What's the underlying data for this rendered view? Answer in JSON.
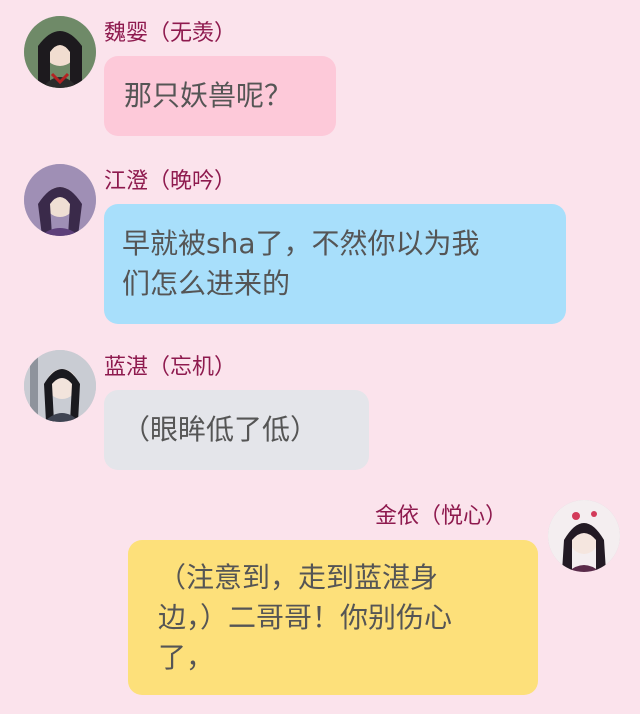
{
  "messages": [
    {
      "sender": "魏婴（无羡）",
      "side": "left",
      "bubble_color": "#fdc9d9",
      "lines": [
        "那只妖兽呢？"
      ]
    },
    {
      "sender": "江澄（晚吟）",
      "side": "left",
      "bubble_color": "#a8dffb",
      "lines": [
        "早就被sha了，不然你以为我",
        "们怎么进来的"
      ]
    },
    {
      "sender": "蓝湛（忘机）",
      "side": "left",
      "bubble_color": "#e4e5ea",
      "lines": [
        "（眼眸低了低）"
      ]
    },
    {
      "sender": "金依（悦心）",
      "side": "right",
      "bubble_color": "#fde07a",
      "lines": [
        "（注意到，走到蓝湛身",
        "边，）二哥哥！你别伤心",
        "了，"
      ]
    }
  ],
  "colors": {
    "background": "#fbe3ec",
    "sender_name": "#8e1a4e",
    "message_text": "#555555"
  }
}
